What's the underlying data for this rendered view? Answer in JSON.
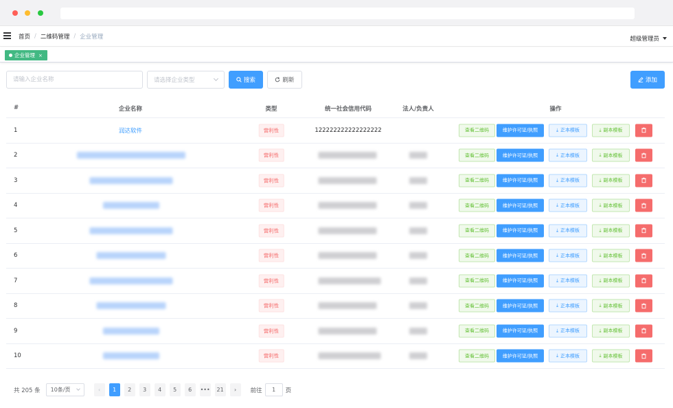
{
  "nav": {
    "breadcrumb": [
      "首页",
      "二维码管理",
      "企业管理"
    ],
    "user": "超级管理员"
  },
  "tags": [
    {
      "label": "企业管理",
      "close": "×"
    }
  ],
  "toolbar": {
    "name_placeholder": "请输入企业名称",
    "type_placeholder": "请选择企业类型",
    "search_label": "搜索",
    "refresh_label": "刷新",
    "add_label": "添加"
  },
  "table": {
    "headers": [
      "#",
      "企业名称",
      "类型",
      "统一社会信用代码",
      "法人/负责人",
      "操作"
    ],
    "rows": [
      {
        "index": "1",
        "name": "润达软件",
        "type": "营利性",
        "credit_code": "122222222222222222",
        "person": ""
      },
      {
        "index": "2",
        "name": "",
        "type": "营利性",
        "credit_code": "",
        "person": ""
      },
      {
        "index": "3",
        "name": "",
        "type": "营利性",
        "credit_code": "",
        "person": ""
      },
      {
        "index": "4",
        "name": "",
        "type": "营利性",
        "credit_code": "",
        "person": ""
      },
      {
        "index": "5",
        "name": "",
        "type": "营利性",
        "credit_code": "",
        "person": ""
      },
      {
        "index": "6",
        "name": "",
        "type": "营利性",
        "credit_code": "",
        "person": ""
      },
      {
        "index": "7",
        "name": "",
        "type": "营利性",
        "credit_code": "",
        "person": ""
      },
      {
        "index": "8",
        "name": "",
        "type": "营利性",
        "credit_code": "",
        "person": ""
      },
      {
        "index": "9",
        "name": "",
        "type": "营利性",
        "credit_code": "",
        "person": ""
      },
      {
        "index": "10",
        "name": "",
        "type": "营利性",
        "credit_code": "",
        "person": ""
      }
    ],
    "actions": {
      "view_qr": "查看二维码",
      "maintain_license": "维护许可证/执照",
      "original_template": "正本模板",
      "copy_template": "副本模板"
    }
  },
  "pagination": {
    "total": "共 205 条",
    "page_size": "10条/页",
    "pages": [
      "1",
      "2",
      "3",
      "4",
      "5",
      "6",
      "•••",
      "21"
    ],
    "current": "1",
    "goto_prefix": "前往",
    "goto_value": "1",
    "goto_suffix": "页"
  },
  "colors": {
    "primary": "#409eff",
    "success": "#42b983",
    "danger": "#f56c6c",
    "green_plain": "#67c23a"
  }
}
